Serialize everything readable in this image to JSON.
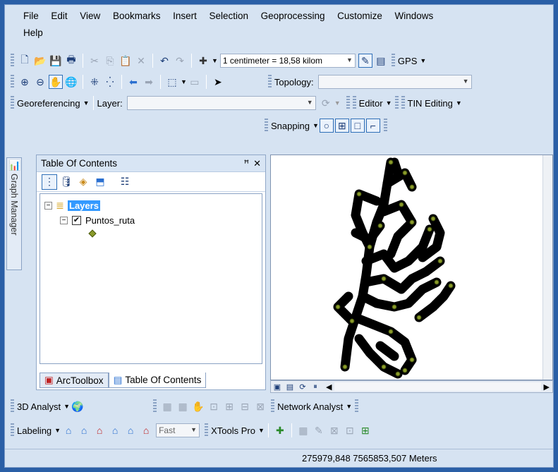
{
  "menu": [
    "File",
    "Edit",
    "View",
    "Bookmarks",
    "Insert",
    "Selection",
    "Geoprocessing",
    "Customize",
    "Windows",
    "Help"
  ],
  "toolbar1": {
    "scale": "1 centimeter = 18,58 kilom",
    "gps": "GPS"
  },
  "toolbar2": {
    "topology_label": "Topology:"
  },
  "toolbar3": {
    "georef": "Georeferencing",
    "layer_label": "Layer:",
    "editor": "Editor",
    "tin": "TIN Editing"
  },
  "toolbar4": {
    "snapping": "Snapping"
  },
  "toc": {
    "title": "Table Of Contents",
    "pin": "↕",
    "close": "✕",
    "root": "Layers",
    "layer": "Puntos_ruta",
    "tab1": "ArcToolbox",
    "tab2": "Table Of Contents"
  },
  "side": {
    "label": "Graph Manager"
  },
  "bottom1": {
    "analyst": "3D Analyst",
    "network": "Network Analyst"
  },
  "bottom2": {
    "labeling": "Labeling",
    "fast": "Fast",
    "xtools": "XTools Pro"
  },
  "status": {
    "coords": "275979,848  7565853,507 Meters"
  },
  "colors": {
    "accent": "#2f6fb8",
    "point": "#8a9a2a",
    "route": "#000000"
  }
}
